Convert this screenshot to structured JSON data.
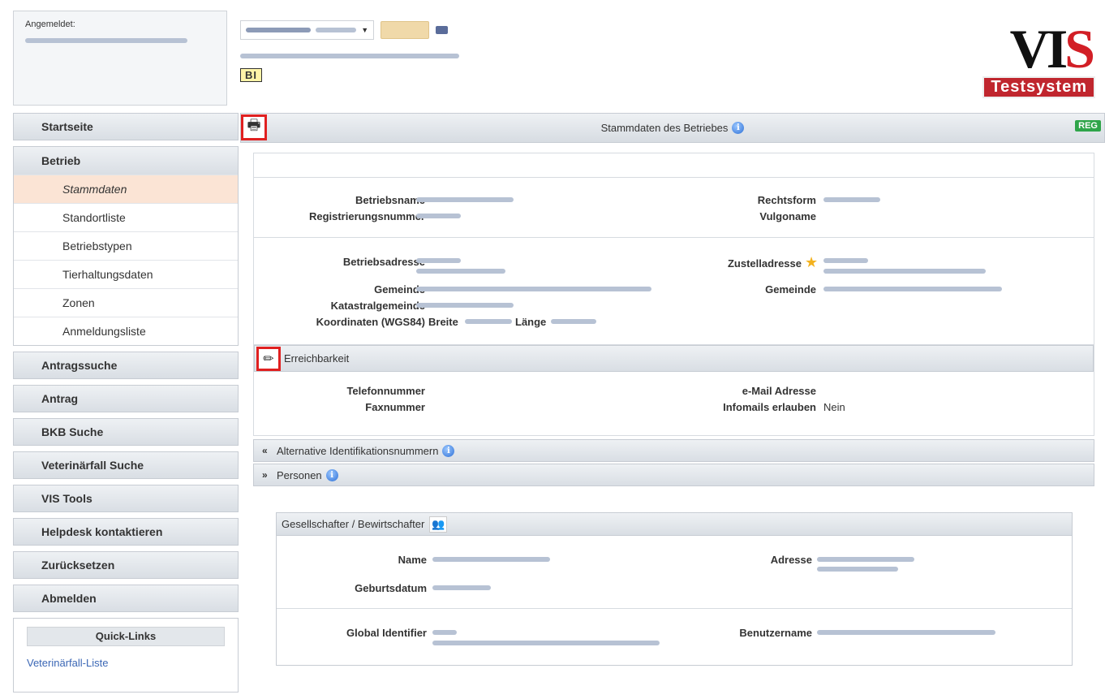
{
  "header": {
    "logged_in_label": "Angemeldet:",
    "business_badge": "BI",
    "logo_text": "VIS",
    "logo_sub": "Testsystem"
  },
  "sidebar": {
    "startseite": "Startseite",
    "betrieb": "Betrieb",
    "betrieb_items": [
      {
        "label": "Stammdaten",
        "active": true
      },
      {
        "label": "Standortliste"
      },
      {
        "label": "Betriebstypen"
      },
      {
        "label": "Tierhaltungsdaten"
      },
      {
        "label": "Zonen"
      },
      {
        "label": "Anmeldungsliste"
      }
    ],
    "antragssuche": "Antragssuche",
    "antrag": "Antrag",
    "bkb_suche": "BKB Suche",
    "veterinaerfall_suche": "Veterinärfall Suche",
    "vis_tools": "VIS Tools",
    "helpdesk": "Helpdesk kontaktieren",
    "zuruecksetzen": "Zurücksetzen",
    "abmelden": "Abmelden",
    "quicklinks_title": "Quick-Links",
    "quicklink_1": "Veterinärfall-Liste"
  },
  "main": {
    "title": "Stammdaten des Betriebes",
    "reg_badge": "REG",
    "labels": {
      "betriebsname": "Betriebsname",
      "registrierungsnummer": "Registrierungsnummer",
      "rechtsform": "Rechtsform",
      "vulgoname": "Vulgoname",
      "betriebsadresse": "Betriebsadresse",
      "gemeinde": "Gemeinde",
      "katastralgemeinde": "Katastralgemeinde",
      "koordinaten": "Koordinaten (WGS84)",
      "breite": "Breite",
      "laenge": "Länge",
      "zustelladresse": "Zustelladresse",
      "gemeinde2": "Gemeinde"
    },
    "erreichbarkeit": {
      "title": "Erreichbarkeit",
      "telefon": "Telefonnummer",
      "fax": "Faxnummer",
      "email": "e-Mail Adresse",
      "infomails": "Infomails erlauben",
      "infomails_value": "Nein"
    },
    "alt_ids": "Alternative Identifikationsnummern",
    "personen": "Personen",
    "person_box": {
      "title": "Gesellschafter / Bewirtschafter",
      "name": "Name",
      "geburtsdatum": "Geburtsdatum",
      "adresse": "Adresse",
      "global_identifier": "Global Identifier",
      "benutzername": "Benutzername"
    }
  }
}
